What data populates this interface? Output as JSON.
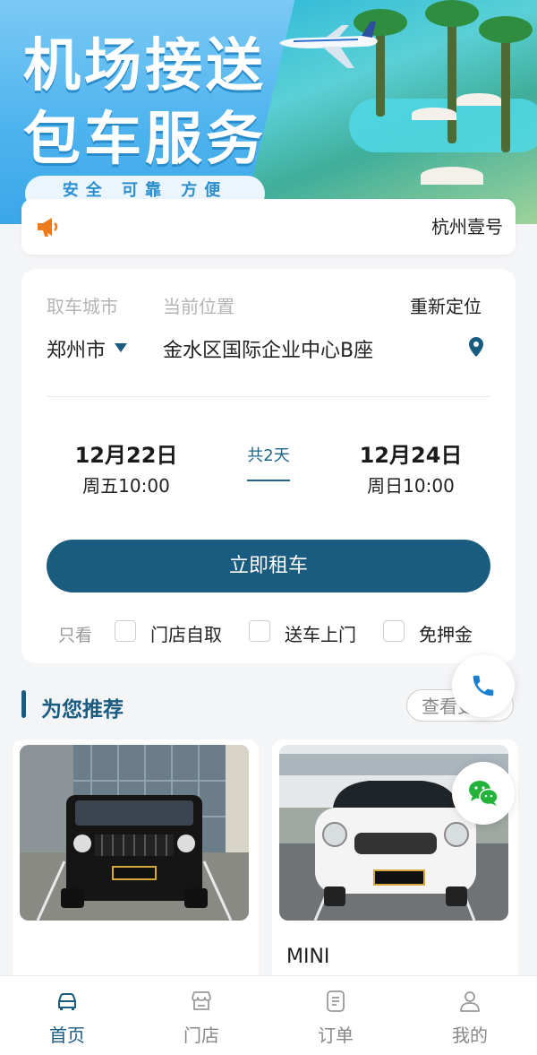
{
  "banner": {
    "title_line1": "机场接送",
    "title_line2": "包车服务",
    "slogan": "安全 可靠 方便"
  },
  "notice": {
    "icon": "megaphone-icon",
    "text": "杭州壹号"
  },
  "rental": {
    "pickup_city_label": "取车城市",
    "current_location_label": "当前位置",
    "relocate_label": "重新定位",
    "city_value": "郑州市",
    "address_value": "金水区国际企业中心B座",
    "start_date": "12月22日",
    "start_time": "周五10:00",
    "duration": "共2天",
    "end_date": "12月24日",
    "end_time": "周日10:00",
    "rent_button": "立即租车",
    "filter_label": "只看",
    "filters": [
      "门店自取",
      "送车上门",
      "免押金"
    ]
  },
  "recommend": {
    "title": "为您推荐",
    "more_button": "查看更多",
    "cars": [
      {
        "name": ""
      },
      {
        "name": "MINI"
      }
    ]
  },
  "tabbar": {
    "tabs": [
      {
        "label": "首页",
        "icon": "car-icon"
      },
      {
        "label": "门店",
        "icon": "store-icon"
      },
      {
        "label": "订单",
        "icon": "order-icon"
      },
      {
        "label": "我的",
        "icon": "user-icon"
      }
    ],
    "active_color": "#1a5b80"
  },
  "colors": {
    "primary": "#1a5b80",
    "accent_orange": "#f07a1a",
    "wechat_green": "#23b33a",
    "phone_blue": "#1a7fd0"
  }
}
